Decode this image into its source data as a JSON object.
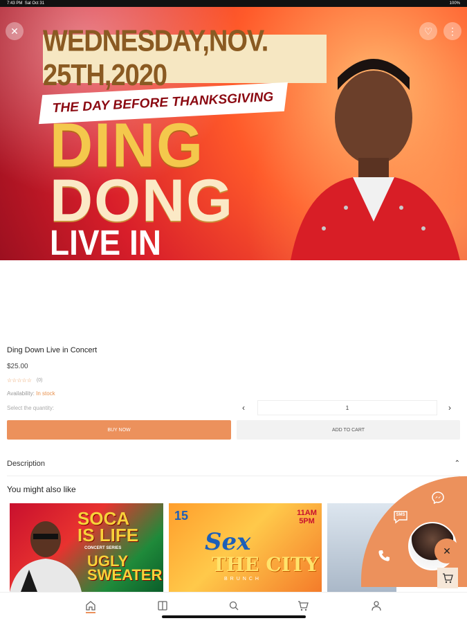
{
  "status_bar": {
    "time": "7:43 PM",
    "date": "Sat Oct 31",
    "battery": "100%"
  },
  "hero": {
    "date_text": "WEDNESDAY,NOV. 25TH,2020",
    "tagline": "THE DAY BEFORE THANKSGIVING",
    "headline_1": "DING",
    "headline_2": "DONG",
    "headline_3": "LIVE IN CONCERT",
    "close_icon": "close-icon",
    "favorite_icon": "heart-icon",
    "more_icon": "more-icon"
  },
  "product": {
    "title": "Ding Down Live in Concert",
    "price": "$25.00",
    "rating_stars": "☆☆☆☆☆",
    "rating_count": "(0)",
    "availability_label": "Availability:",
    "availability_value": "In stock",
    "quantity_label": "Select the quantity:",
    "quantity_value": "1",
    "buy_now_label": "BUY NOW",
    "add_to_cart_label": "ADD TO CART"
  },
  "description": {
    "label": "Description"
  },
  "recommendations": {
    "heading": "You might also like",
    "cards": [
      {
        "title_1": "SOCA",
        "title_2": "IS LIFE",
        "subtitle": "CONCERT SERIES",
        "title_3": "UGLY SWEATER"
      },
      {
        "date": "15",
        "time": "11AM 5PM",
        "title_1": "Sex",
        "title_2": "THE CITY",
        "subtitle": "BRUNCH"
      },
      {
        "title_1": ""
      }
    ]
  },
  "contact_widget": {
    "messenger_icon": "messenger-icon",
    "sms_label": "SMS",
    "phone_icon": "phone-icon",
    "close_icon": "close-icon",
    "cart_icon": "cart-icon"
  },
  "bottom_nav": {
    "items": [
      {
        "icon": "home-icon"
      },
      {
        "icon": "catalog-icon"
      },
      {
        "icon": "search-icon"
      },
      {
        "icon": "cart-icon"
      },
      {
        "icon": "account-icon"
      }
    ]
  },
  "colors": {
    "accent": "#ec915c",
    "star": "#e8924e"
  }
}
